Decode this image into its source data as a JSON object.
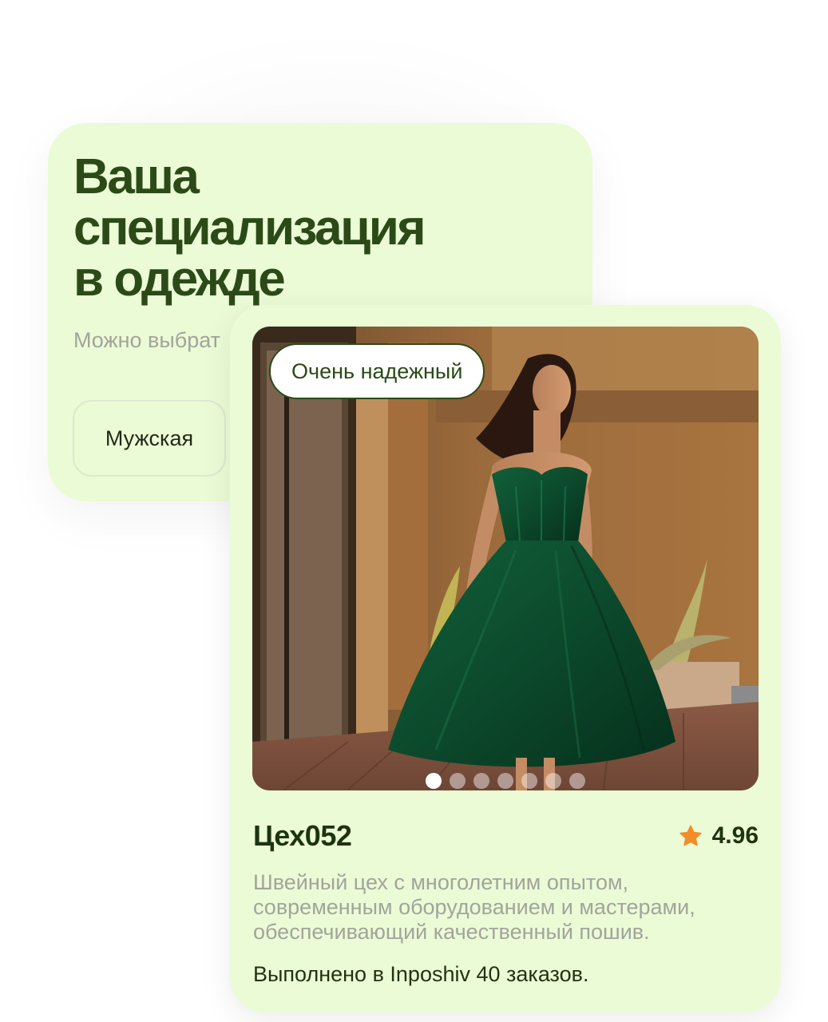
{
  "specialization": {
    "title_lines": [
      "Ваша",
      "специализация",
      "в одежде"
    ],
    "subtitle": "Можно выбрат",
    "options": [
      "Мужская"
    ]
  },
  "workshop_card": {
    "badge": "Очень надежный",
    "photo": {
      "subject": "dress-photo",
      "dress_color": "#0f4a2c",
      "gallery_total": 7,
      "gallery_active": 1
    },
    "name": "Цех052",
    "rating": "4.96",
    "rating_icon": "star-icon",
    "rating_color": "#f28c28",
    "description": "Швейный цех с многолетним опытом, современным оборудованием и мастерами, обеспечивающий качественный пошив.",
    "orders_text": "Выполнено в Inposhiv 40 заказов."
  },
  "colors": {
    "card_background": "#ebfbd6",
    "title_green": "#2b4a17",
    "muted_text": "#a1a59b"
  }
}
